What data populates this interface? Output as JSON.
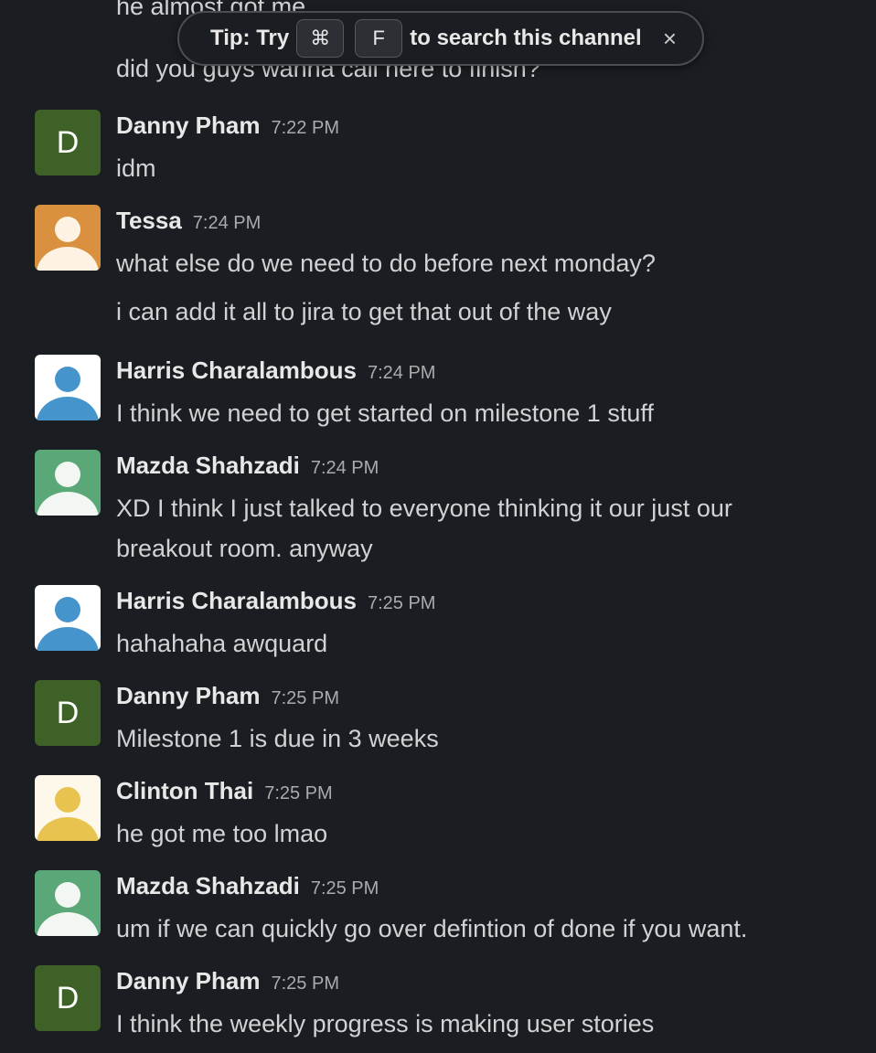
{
  "previous": {
    "line1": "he almost got me",
    "line2": "did you guys wanna call here to finish?"
  },
  "tip": {
    "prefix": "Tip: Try",
    "key1": "⌘",
    "key2": "F",
    "suffix": "to search this channel",
    "close": "×"
  },
  "colors": {
    "background": "#1a1d21",
    "danny_avatar": "#3d6126",
    "tessa_avatar": "#d9913f",
    "harris_avatar": "#ffffff",
    "mazda_avatar": "#5aa877",
    "clinton_avatar": "#fdf8ea"
  },
  "messages": [
    {
      "author": "Danny Pham",
      "time": "7:22 PM",
      "avatar_letter": "D",
      "text": "idm"
    },
    {
      "author": "Tessa",
      "time": "7:24 PM",
      "text": "what else do we need to do before next monday?",
      "continuation": "i can add it all to jira to get that out of the way"
    },
    {
      "author": "Harris Charalambous",
      "time": "7:24 PM",
      "text": "I think we need to get started on milestone 1 stuff"
    },
    {
      "author": "Mazda Shahzadi",
      "time": "7:24 PM",
      "text": "XD I think I just talked to everyone thinking it our just our",
      "text2": "breakout room. anyway"
    },
    {
      "author": "Harris Charalambous",
      "time": "7:25 PM",
      "text": "hahahaha awquard"
    },
    {
      "author": "Danny Pham",
      "time": "7:25 PM",
      "avatar_letter": "D",
      "text": "Milestone 1 is due in 3 weeks"
    },
    {
      "author": "Clinton Thai",
      "time": "7:25 PM",
      "text": "he got me too lmao"
    },
    {
      "author": "Mazda Shahzadi",
      "time": "7:25 PM",
      "text": "um if we can quickly go over defintion of done if you want."
    },
    {
      "author": "Danny Pham",
      "time": "7:25 PM",
      "avatar_letter": "D",
      "text": "I think the weekly progress is making user stories"
    }
  ]
}
